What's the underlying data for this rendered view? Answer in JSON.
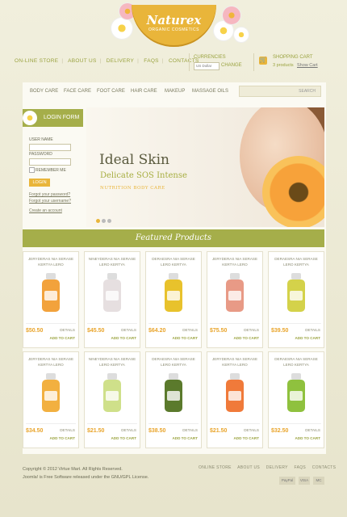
{
  "logo": {
    "name": "Naturex",
    "tagline": "ORGANIC COSMETICS"
  },
  "topnav": [
    "ON-LINE STORE",
    "ABOUT US",
    "DELIVERY",
    "FAQS",
    "CONTACTS"
  ],
  "currency": {
    "label": "CURRENCIES",
    "selected": "US Dollar",
    "change_label": "CHANGE"
  },
  "cart": {
    "title": "SHOPPING CART",
    "count_text": "3 products",
    "show_label": "Show Cart"
  },
  "categories": [
    "BODY CARE",
    "FACE CARE",
    "FOOT CARE",
    "HAIR CARE",
    "MAKEUP",
    "MASSAGE OILS"
  ],
  "search": {
    "label": "SEARCH"
  },
  "login": {
    "title": "LOGIN FORM",
    "user_label": "USER NAME",
    "pass_label": "PASSWORD",
    "remember_label": "REMEMBER ME",
    "button": "LOGIN",
    "forgot_password": "Forgot your password?",
    "forgot_username": "Forgot your username?",
    "create_account": "Create an account"
  },
  "banner": {
    "title": "Ideal Skin",
    "subtitle": "Delicate SOS Intense",
    "tagline": "NUTRITION BODY CARE"
  },
  "featured": {
    "title": "Featured Products"
  },
  "products": [
    {
      "line1": "JERYDERAS NIA SERASE",
      "line2": "KERTYA LERO",
      "price": "$50.50",
      "color": "#f2a23c"
    },
    {
      "line1": "NINEYDERAS NIA SERASE",
      "line2": "LERO KERTYA",
      "price": "$45.50",
      "color": "#e6dfe0"
    },
    {
      "line1": "DERAESRA NIA SERASE",
      "line2": "LERO KERTYA",
      "price": "$64.20",
      "color": "#e8c22c"
    },
    {
      "line1": "JERYDERAS NIA SERASE",
      "line2": "KERTYA LERO",
      "price": "$75.50",
      "color": "#e89a86"
    },
    {
      "line1": "DERAESRA NIA SERASE",
      "line2": "LERO KERTYA",
      "price": "$39.50",
      "color": "#d4d24a"
    },
    {
      "line1": "JERYDERAS NIA SERASE",
      "line2": "KERTYA LERO",
      "price": "$34.50",
      "color": "#f2b040"
    },
    {
      "line1": "NINEYDERAS NIA SERASE",
      "line2": "LERO KERTYA",
      "price": "$21.50",
      "color": "#cfe08a"
    },
    {
      "line1": "DERAESRA NIA SERASE",
      "line2": "LERO KERTYA",
      "price": "$38.50",
      "color": "#5b7a2c"
    },
    {
      "line1": "JERYDERAS NIA SERASE",
      "line2": "KERTYA LERO",
      "price": "$21.50",
      "color": "#f07a3a"
    },
    {
      "line1": "DERAESRA NIA SERASE",
      "line2": "LERO KERTYA",
      "price": "$32.50",
      "color": "#8fc13e"
    }
  ],
  "details_label": "DETAILS",
  "add_label": "ADD TO CART",
  "footer": {
    "copyright": "Copyright © 2012 Virtue Mart. All Rights Reserved.",
    "joomla": "Joomla! is Free Software released under the GNU/GPL License.",
    "nav": [
      "ONLINE STORE",
      "ABOUT US",
      "DELIVERY",
      "FAQS",
      "CONTACTS"
    ],
    "payments": [
      "PayPal",
      "VISA",
      "MC"
    ]
  }
}
